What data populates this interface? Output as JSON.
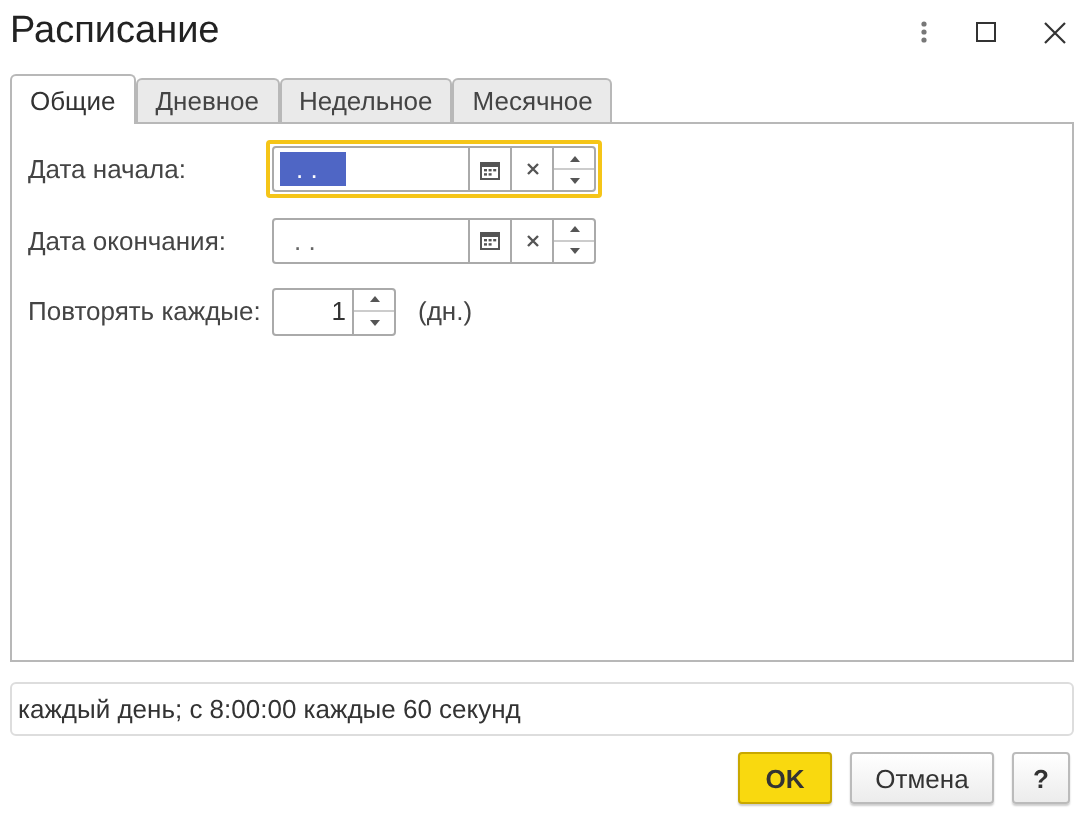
{
  "window": {
    "title": "Расписание"
  },
  "tabs": [
    {
      "label": "Общие",
      "selected": true
    },
    {
      "label": "Дневное",
      "selected": false
    },
    {
      "label": "Недельное",
      "selected": false
    },
    {
      "label": "Месячное",
      "selected": false
    }
  ],
  "fields": [
    {
      "kind": "date",
      "label": "Дата начала:",
      "value": ".  .",
      "focused": true
    },
    {
      "kind": "date",
      "label": "Дата окончания:",
      "value": ".  .",
      "focused": false
    },
    {
      "kind": "number",
      "label": "Повторять каждые:",
      "value": "1",
      "unit": "(дн.)"
    }
  ],
  "summary": "каждый день; с 8:00:00 каждые 60 секунд",
  "buttons": [
    {
      "label": "OK",
      "kind": "primary"
    },
    {
      "label": "Отмена",
      "kind": "normal"
    },
    {
      "label": "?",
      "kind": "help"
    }
  ]
}
